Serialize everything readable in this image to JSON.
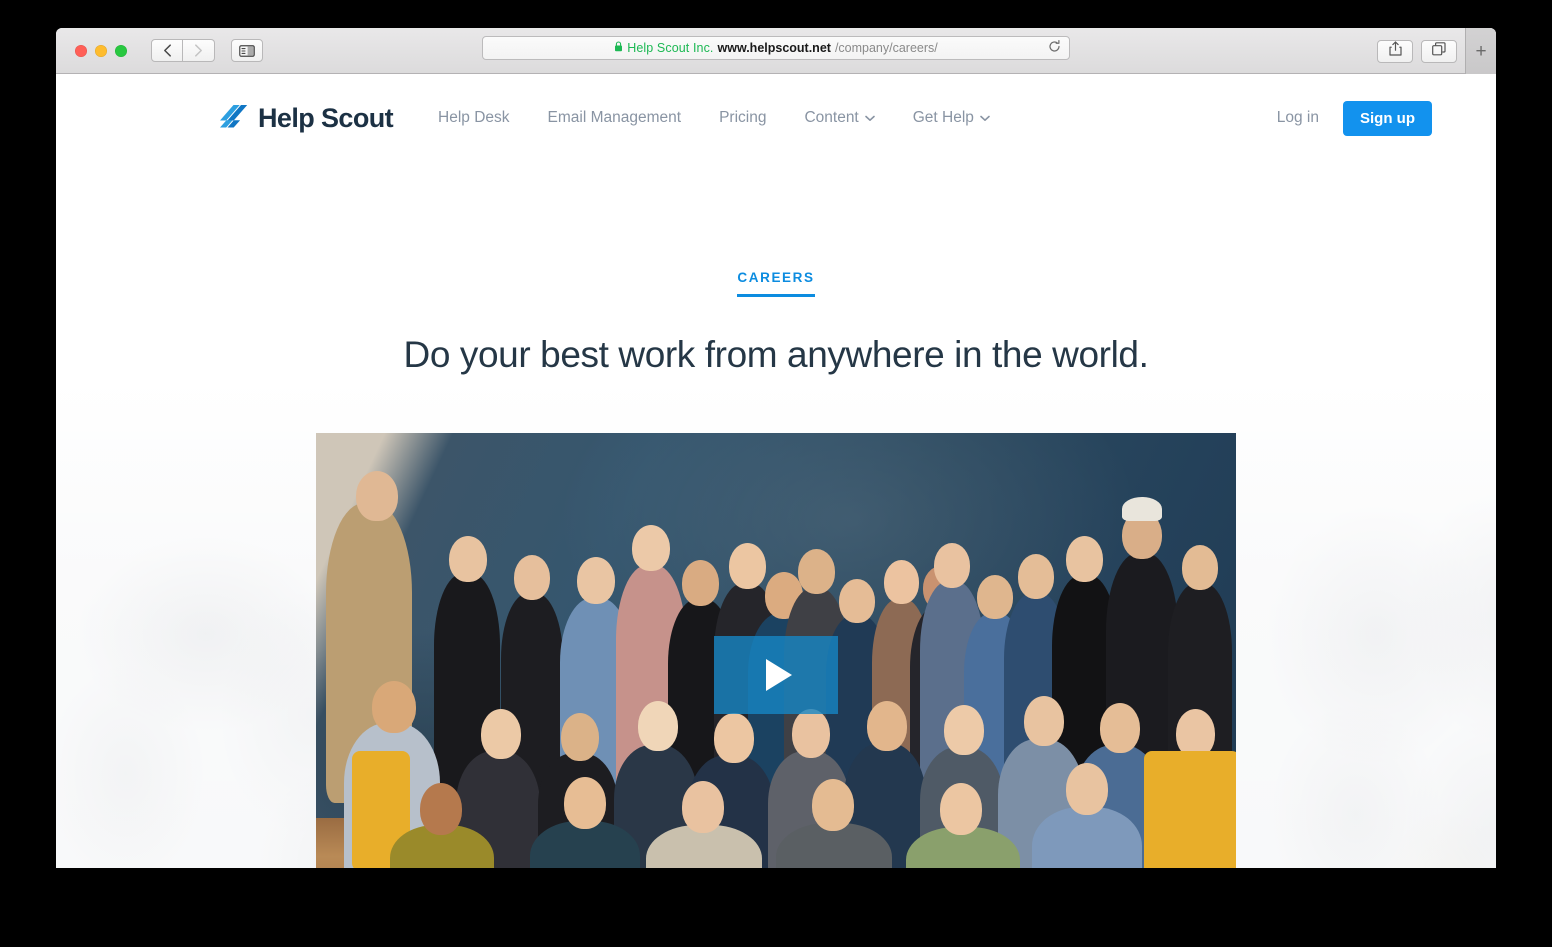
{
  "browser": {
    "traffic_lights": [
      "close",
      "minimize",
      "maximize"
    ],
    "back_label": "Back",
    "forward_label": "Forward",
    "sidebar_label": "Show Sidebar",
    "share_label": "Share",
    "tabs_label": "Show Tab Overview",
    "new_tab_label": "+",
    "reload_label": "Reload",
    "address": {
      "secure_name": "Help Scout Inc.",
      "host": "www.helpscout.net",
      "path": "/company/careers/",
      "lock_icon": "lock-icon",
      "reload_icon": "reload-icon"
    }
  },
  "site": {
    "logo": {
      "mark_icon": "helpscout-logo-mark",
      "text": "Help Scout"
    },
    "nav": [
      {
        "label": "Help Desk",
        "has_dropdown": false
      },
      {
        "label": "Email Management",
        "has_dropdown": false
      },
      {
        "label": "Pricing",
        "has_dropdown": false
      },
      {
        "label": "Content",
        "has_dropdown": true
      },
      {
        "label": "Get Help",
        "has_dropdown": true
      }
    ],
    "login_label": "Log in",
    "signup_label": "Sign up"
  },
  "hero": {
    "eyebrow": "CAREERS",
    "title": "Do your best work from anywhere in the world.",
    "video": {
      "play_icon": "play-icon",
      "alt": "Help Scout team group photo"
    }
  },
  "colors": {
    "brand_blue": "#1292ee",
    "eyebrow_blue": "#0c8ce0",
    "heading_navy": "#253746",
    "nav_gray": "#8994a3",
    "play_overlay": "#1686c4"
  }
}
